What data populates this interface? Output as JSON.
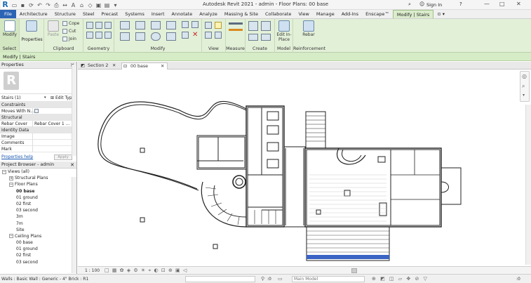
{
  "window": {
    "title": "Autodesk Revit 2021 - admin - Floor Plans: 00 base",
    "sign_in": "Sign In",
    "logo_letter": "R",
    "controls": [
      "—",
      "□",
      "✕"
    ]
  },
  "tabs": [
    "File",
    "Architecture",
    "Structure",
    "Steel",
    "Precast",
    "Systems",
    "Insert",
    "Annotate",
    "Analyze",
    "Massing & Site",
    "Collaborate",
    "View",
    "Manage",
    "Add-Ins",
    "Enscape™",
    "Modify | Stairs"
  ],
  "ribbon": {
    "modify_label": "Modify",
    "properties_label": "Properties",
    "clipboard": {
      "cope": "Cope",
      "cut": "Cut",
      "join": "Join",
      "paste": "Paste"
    },
    "edit_in_place": "Edit In-Place",
    "rebar": "Rebar",
    "panels": [
      "Select",
      "Properties",
      "Clipboard",
      "Geometry",
      "Modify",
      "View",
      "Measure",
      "Create",
      "Model",
      "Reinforcement"
    ]
  },
  "context_bar": "Modify | Stairs",
  "properties": {
    "title": "Properties",
    "type_selector": "Stairs (1)",
    "edit_type": "Edit Type",
    "groups": {
      "constraints": "Constraints",
      "moves_with": "Moves With N...",
      "structural": "Structural",
      "rebar_cover": "Rebar Cover",
      "rebar_cover_val": "Rebar Cover 1 ...",
      "identity": "Identity Data",
      "image": "Image",
      "comments": "Comments",
      "mark": "Mark"
    },
    "help_link": "Properties help",
    "apply": "Apply"
  },
  "browser": {
    "title": "Project Browser - admin",
    "items": [
      {
        "label": "Views (all)",
        "level": 0,
        "exp": "−"
      },
      {
        "label": "Structural Plans",
        "level": 1,
        "exp": "+"
      },
      {
        "label": "Floor Plans",
        "level": 1,
        "exp": "−"
      },
      {
        "label": "00 base",
        "level": 2,
        "sel": true
      },
      {
        "label": "01 ground",
        "level": 2
      },
      {
        "label": "02 first",
        "level": 2
      },
      {
        "label": "03 second",
        "level": 2
      },
      {
        "label": "3m",
        "level": 2
      },
      {
        "label": "7m",
        "level": 2
      },
      {
        "label": "Site",
        "level": 2
      },
      {
        "label": "Ceiling Plans",
        "level": 1,
        "exp": "−"
      },
      {
        "label": "00 base",
        "level": 2
      },
      {
        "label": "01 ground",
        "level": 2
      },
      {
        "label": "02 first",
        "level": 2
      },
      {
        "label": "03 second",
        "level": 2
      }
    ]
  },
  "view_tabs": [
    {
      "label": "Section 2",
      "active": false
    },
    {
      "label": "00 base",
      "active": true
    }
  ],
  "view_bar": {
    "scale": "1 : 100"
  },
  "status_bar": {
    "message": "Walls : Basic Wall : Generic - 4\" Brick : R1",
    "count": ":0",
    "model": "Main Model",
    "filter": ":0"
  },
  "colors": {
    "accent": "#2b64b5",
    "ribbon": "#e3f0d8",
    "context": "#d6ecc6",
    "stair_blue": "#3a63c4"
  }
}
